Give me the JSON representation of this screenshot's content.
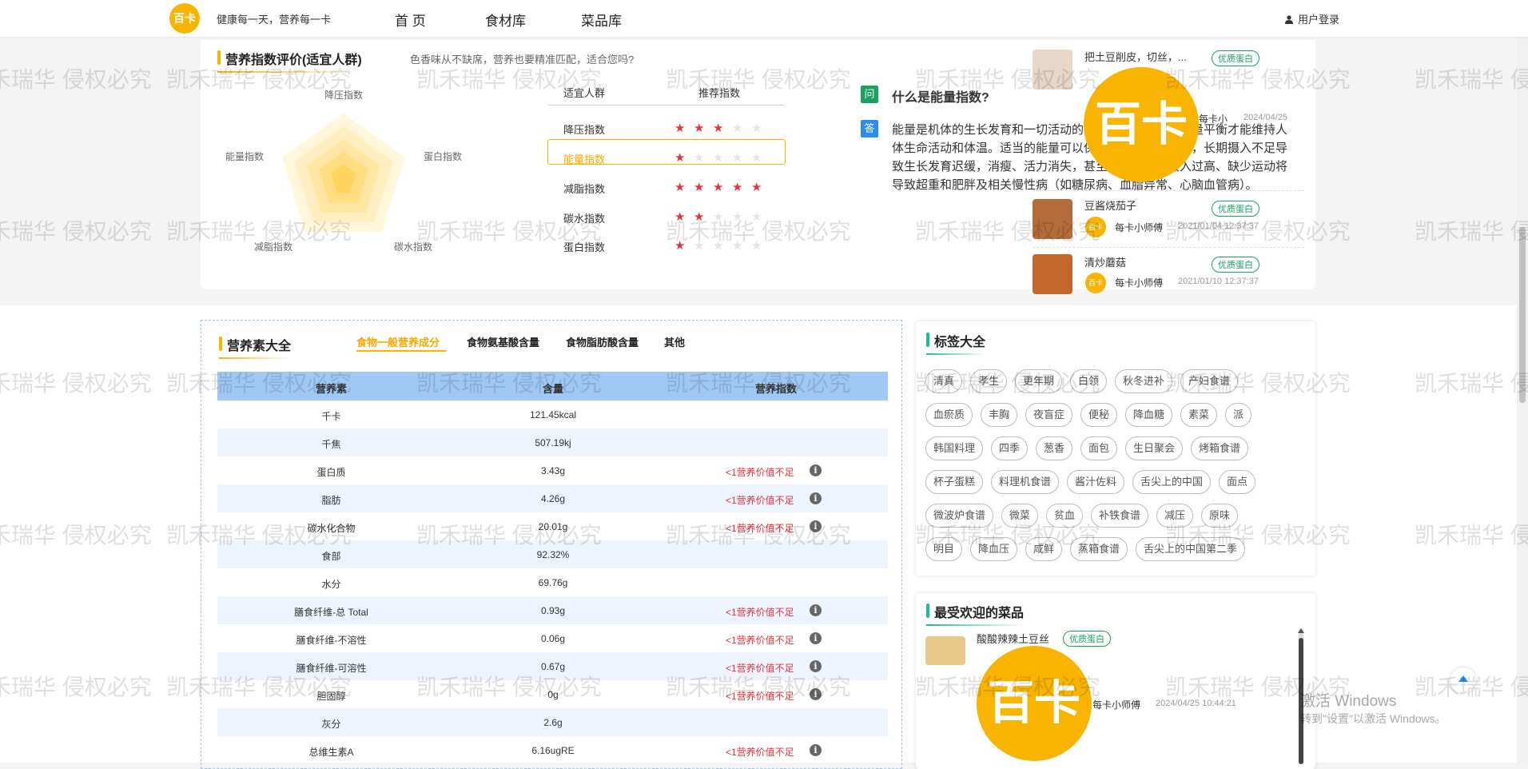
{
  "header": {
    "logo_text": "百卡",
    "slogan": "健康每一天，营养每一卡",
    "nav": [
      "首 页",
      "食材库",
      "菜品库"
    ],
    "login": "用户登录"
  },
  "nutrition_index": {
    "title": "营养指数评价(适宜人群)",
    "subtitle": "色香味从不缺席，营养也要精准匹配，适合您吗?",
    "radar_labels": [
      "降压指数",
      "蛋白指数",
      "碳水指数",
      "减脂指数",
      "能量指数"
    ],
    "table_headers": [
      "适宜人群",
      "推荐指数"
    ],
    "rows": [
      {
        "label": "降压指数",
        "stars": 3
      },
      {
        "label": "能量指数",
        "stars": 1
      },
      {
        "label": "减脂指数",
        "stars": 5
      },
      {
        "label": "碳水指数",
        "stars": 2
      },
      {
        "label": "蛋白指数",
        "stars": 1
      }
    ],
    "selected_row": "能量指数"
  },
  "qa": {
    "q_icon": "问",
    "a_icon": "答",
    "question": "什么是能量指数?",
    "answer": "能量是机体的生长发育和一切活动的基础，维持良好的能量平衡才能维持人体生命活动和体温。适当的能量可以保持良好的健康状况，长期摄入不足导致生长发育迟缓，消瘦、活力消失，甚至死亡；长期摄入过高、缺少运动将导致超重和肥胖及相关慢性病（如糖尿病、血脂异常、心脑血管病）。"
  },
  "top_recipes": [
    {
      "name": "把土豆削皮，切丝，...",
      "badge": "优质蛋白",
      "author": "每卡小",
      "date": "2024/04/25"
    },
    {
      "name": "豆酱烧茄子",
      "badge": "优质蛋白",
      "author": "每卡小师傅",
      "date": "2021/01/04 12:37:37"
    },
    {
      "name": "清炒蘑菇",
      "badge": "优质蛋白",
      "author": "每卡小师傅",
      "date": "2021/01/10 12:37:37"
    }
  ],
  "nutrients": {
    "title": "营养素大全",
    "tabs": [
      "食物一般营养成分",
      "食物氨基酸含量",
      "食物脂肪酸含量",
      "其他"
    ],
    "active_tab": "食物一般营养成分",
    "headers": [
      "营养素",
      "含量",
      "营养指数"
    ],
    "rows": [
      {
        "name": "千卡",
        "value": "121.45kcal",
        "note": ""
      },
      {
        "name": "千焦",
        "value": "507.19kj",
        "note": ""
      },
      {
        "name": "蛋白质",
        "value": "3.43g",
        "note": "<1营养价值不足"
      },
      {
        "name": "脂肪",
        "value": "4.26g",
        "note": "<1营养价值不足"
      },
      {
        "name": "碳水化合物",
        "value": "20.01g",
        "note": "<1营养价值不足"
      },
      {
        "name": "食部",
        "value": "92.32%",
        "note": ""
      },
      {
        "name": "水分",
        "value": "69.76g",
        "note": ""
      },
      {
        "name": "膳食纤维-总 Total",
        "value": "0.93g",
        "note": "<1营养价值不足"
      },
      {
        "name": "膳食纤维-不溶性",
        "value": "0.06g",
        "note": "<1营养价值不足"
      },
      {
        "name": "膳食纤维-可溶性",
        "value": "0.67g",
        "note": "<1营养价值不足"
      },
      {
        "name": "胆固醇",
        "value": "0g",
        "note": "<1营养价值不足"
      },
      {
        "name": "灰分",
        "value": "2.6g",
        "note": ""
      },
      {
        "name": "总维生素A",
        "value": "6.16ugRE",
        "note": "<1营养价值不足"
      }
    ],
    "info_icon": "i"
  },
  "tags": {
    "title": "标签大全",
    "rows": [
      [
        "清真",
        "孝生",
        "更年期",
        "白领",
        "秋冬进补",
        "产妇食谱"
      ],
      [
        "血瘀质",
        "丰胸",
        "夜盲症",
        "便秘",
        "降血糖",
        "素菜",
        "派"
      ],
      [
        "韩国料理",
        "四季",
        "葱香",
        "面包",
        "生日聚会",
        "烤箱食谱"
      ],
      [
        "杯子蛋糕",
        "料理机食谱",
        "酱汁佐料",
        "舌尖上的中国",
        "面点"
      ],
      [
        "微波炉食谱",
        "微菜",
        "贫血",
        "补铁食谱",
        "减压",
        "原味"
      ],
      [
        "明目",
        "降血压",
        "咸鲜",
        "蒸箱食谱",
        "舌尖上的中国第二季"
      ]
    ]
  },
  "popular": {
    "title": "最受欢迎的菜品",
    "items": [
      {
        "name": "酸酸辣辣土豆丝",
        "badge": "优质蛋白",
        "author": "每卡小师傅",
        "date": "2024/04/25 10:44:21"
      }
    ]
  },
  "watermark": "凯禾瑞华 侵权必究",
  "windows": {
    "line1": "激活 Windows",
    "line2": "转到\"设置\"以激活 Windows。"
  },
  "colors": {
    "accent": "#f9b400",
    "star": "#e8323c",
    "green": "#1aa260",
    "table_head": "#9fc8f5"
  }
}
